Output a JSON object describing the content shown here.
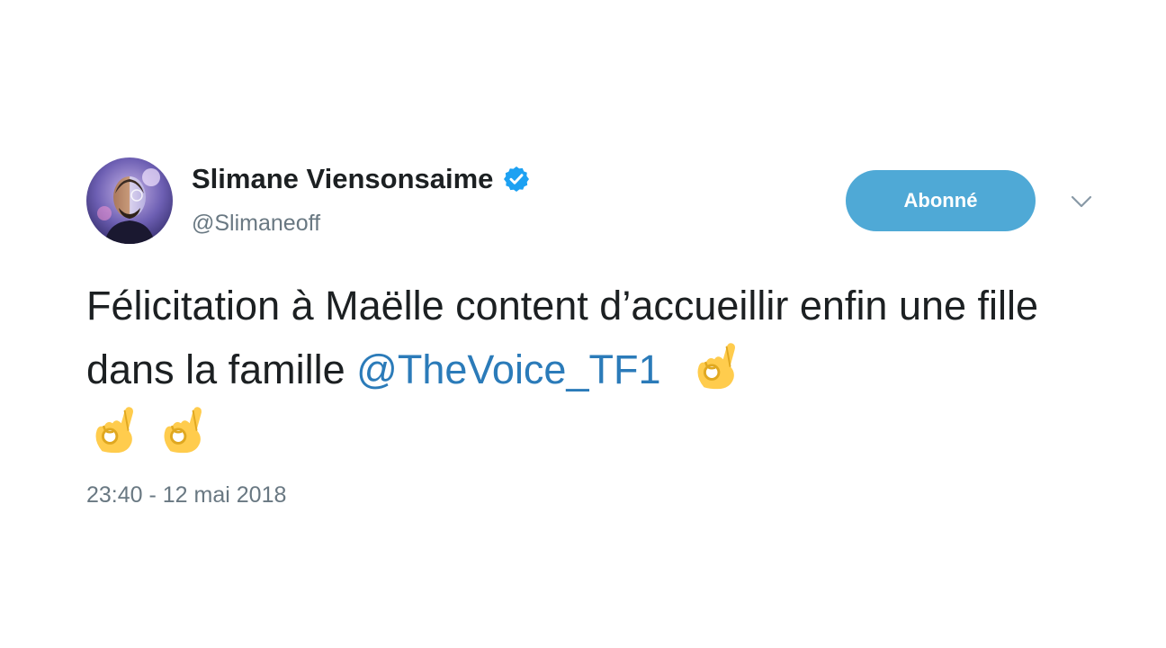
{
  "tweet": {
    "author": {
      "display_name": "Slimane Viensonsaime",
      "handle": "@Slimaneoff",
      "verified_icon": "verified-badge-icon",
      "avatar_icon": "profile-avatar"
    },
    "follow_button_label": "Abonné",
    "menu_icon": "chevron-down-icon",
    "text": {
      "part1": "Félicitation à Maëlle content d’accueillir enfin une fille dans la famille ",
      "mention": "@TheVoice_TF1",
      "emoji_icon": "ok-hand-emoji",
      "emoji_count": 3
    },
    "timestamp": "23:40 - 12 mai 2018"
  },
  "colors": {
    "text": "#1c2022",
    "muted": "#697882",
    "link": "#2b7bb9",
    "button": "#4fa9d6",
    "verified": "#1da1f2",
    "emoji": "#ffcc4d"
  }
}
